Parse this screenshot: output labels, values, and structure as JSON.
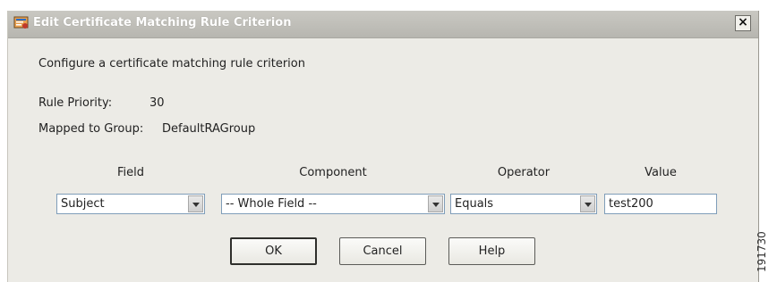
{
  "window": {
    "title": "Edit Certificate Matching Rule Criterion",
    "close_symbol": "×",
    "icon": "certificate-icon"
  },
  "description": "Configure a certificate matching rule criterion",
  "rule_priority": {
    "label": "Rule Priority:",
    "value": "30"
  },
  "mapped_group": {
    "label": "Mapped to Group:",
    "value": "DefaultRAGroup"
  },
  "columns": {
    "field": "Field",
    "component": "Component",
    "operator": "Operator",
    "value": "Value"
  },
  "inputs": {
    "field": "Subject",
    "component": "-- Whole Field --",
    "operator": "Equals",
    "value": "test200"
  },
  "buttons": {
    "ok": "OK",
    "cancel": "Cancel",
    "help": "Help"
  },
  "side_id": "191730"
}
